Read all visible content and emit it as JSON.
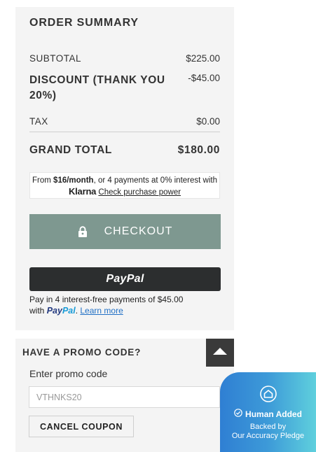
{
  "summary": {
    "title": "ORDER SUMMARY",
    "subtotal_label": "SUBTOTAL",
    "subtotal_value": "$225.00",
    "discount_label": "DISCOUNT (THANK YOU 20%)",
    "discount_value": "-$45.00",
    "tax_label": "TAX",
    "tax_value": "$0.00",
    "grand_total_label": "GRAND TOTAL",
    "grand_total_value": "$180.00"
  },
  "klarna": {
    "prefix": "From ",
    "monthly": "$16/month",
    "middle": ", or 4 payments at 0% interest with ",
    "logo": "Klarna",
    "link": "Check purchase power"
  },
  "checkout": {
    "label": "CHECKOUT",
    "icon": "lock-icon",
    "color": "#7e9890"
  },
  "paypal": {
    "button_label": "PayPal",
    "note_line1": "Pay in 4 interest-free payments of $45.00",
    "note_with": "with ",
    "note_brand_a": "Pay",
    "note_brand_b": "Pal",
    "note_dot": ". ",
    "learn_more": "Learn more"
  },
  "promo": {
    "title": "HAVE A PROMO CODE?",
    "toggle_icon": "chevron-up-icon",
    "field_label": "Enter promo code",
    "field_value": "VTHNKS20",
    "cancel_label": "CANCEL COUPON"
  },
  "badge": {
    "icon": "house-icon",
    "check_icon": "check-circle-icon",
    "headline": "Human Added",
    "line1": "Backed by",
    "line2": "Our Accuracy Pledge"
  }
}
